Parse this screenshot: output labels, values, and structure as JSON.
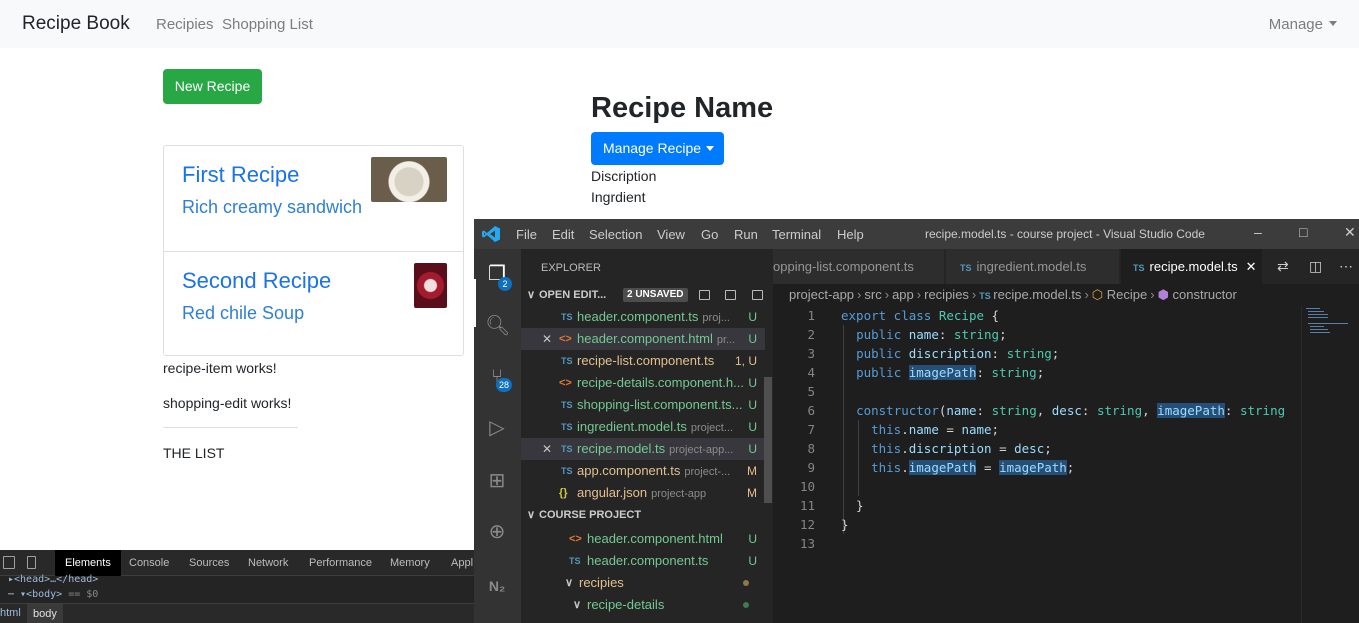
{
  "app": {
    "brand": "Recipe Book",
    "nav": [
      "Recipies",
      "Shopping List"
    ],
    "manage": "Manage",
    "new_recipe": "New Recipe",
    "recipes": [
      {
        "name": "First Recipe",
        "description": "Rich creamy sandwich"
      },
      {
        "name": "Second Recipe",
        "description": "Red chile Soup"
      }
    ],
    "messages": [
      "recipe-item works!",
      "shopping-edit works!"
    ],
    "list_label": "THE LIST",
    "detail": {
      "title": "Recipe Name",
      "manage_button": "Manage Recipe",
      "description": "Discription",
      "ingredient": "Ingrdient"
    }
  },
  "devtools": {
    "tabs": [
      "Elements",
      "Console",
      "Sources",
      "Network",
      "Performance",
      "Memory",
      "Appl"
    ],
    "active_tab": "Elements",
    "lines": [
      {
        "text": "▸<head>…</head>",
        "suffix": ""
      },
      {
        "text": "⋯ ▾<body>",
        "suffix": "== $0"
      }
    ],
    "crumbs": [
      "html",
      "body"
    ]
  },
  "vscode": {
    "menu": [
      "File",
      "Edit",
      "Selection",
      "View",
      "Go",
      "Run",
      "Terminal",
      "Help"
    ],
    "window_title": "recipe.model.ts - course project - Visual Studio Code",
    "badges": {
      "explorer": "2",
      "scm": "28"
    },
    "explorer_title": "EXPLORER",
    "open_editors_label": "OPEN EDIT...",
    "unsaved_label": "2 UNSAVED",
    "open_editors": [
      {
        "type": "TS",
        "name": "header.component.ts",
        "dir": "proj...",
        "status": "U",
        "close": ""
      },
      {
        "type": "<>",
        "name": "header.component.html",
        "dir": "pr...",
        "status": "U",
        "close": "✕"
      },
      {
        "type": "TS",
        "name": "recipe-list.component.ts",
        "dir": "",
        "status": "1, U",
        "close": ""
      },
      {
        "type": "<>",
        "name": "recipe-details.component.h...",
        "dir": "",
        "status": "U",
        "close": ""
      },
      {
        "type": "TS",
        "name": "shopping-list.component.ts...",
        "dir": "",
        "status": "U",
        "close": ""
      },
      {
        "type": "TS",
        "name": "ingredient.model.ts",
        "dir": "project...",
        "status": "U",
        "close": ""
      },
      {
        "type": "TS",
        "name": "recipe.model.ts",
        "dir": "project-app...",
        "status": "U",
        "close": "✕"
      },
      {
        "type": "TS",
        "name": "app.component.ts",
        "dir": "project-...",
        "status": "M",
        "close": ""
      },
      {
        "type": "{}",
        "name": "angular.json",
        "dir": "project-app",
        "status": "M",
        "close": ""
      }
    ],
    "project_label": "COURSE PROJECT",
    "project_files": [
      {
        "type": "<>",
        "name": "header.component.html",
        "status": "U"
      },
      {
        "type": "TS",
        "name": "header.component.ts",
        "status": "U"
      },
      {
        "type": "folder",
        "name": "recipies",
        "status": ""
      },
      {
        "type": "folder",
        "name": "recipe-details",
        "status": ""
      }
    ],
    "tabs": [
      {
        "name": "opping-list.component.ts",
        "active": false
      },
      {
        "name": "ingredient.model.ts",
        "active": false
      },
      {
        "name": "recipe.model.ts",
        "active": true
      }
    ],
    "breadcrumbs": [
      "project-app",
      "src",
      "app",
      "recipies",
      "recipe.model.ts",
      "Recipe",
      "constructor"
    ],
    "line_numbers": [
      "1",
      "2",
      "3",
      "4",
      "5",
      "6",
      "7",
      "8",
      "9",
      "10",
      "11",
      "12",
      "13"
    ]
  }
}
